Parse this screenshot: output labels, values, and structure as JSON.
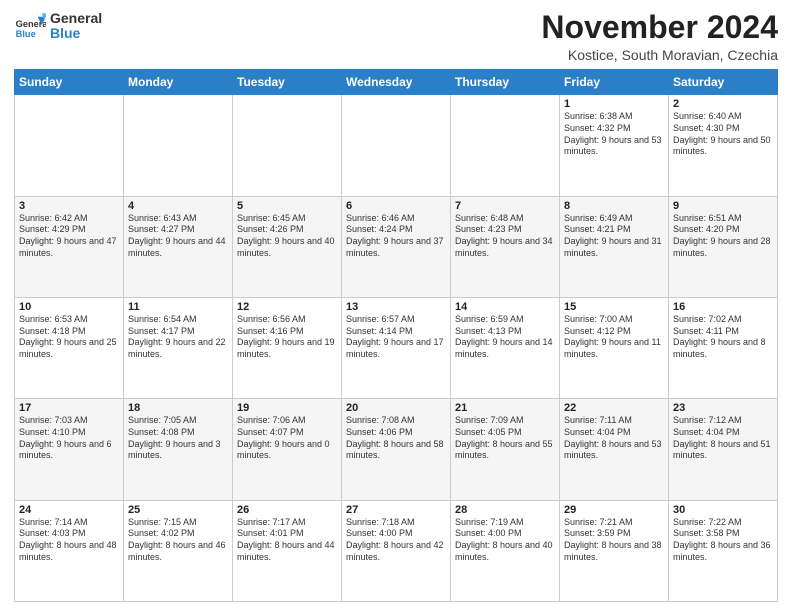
{
  "logo": {
    "general": "General",
    "blue": "Blue"
  },
  "title": "November 2024",
  "location": "Kostice, South Moravian, Czechia",
  "days_of_week": [
    "Sunday",
    "Monday",
    "Tuesday",
    "Wednesday",
    "Thursday",
    "Friday",
    "Saturday"
  ],
  "weeks": [
    [
      {
        "day": "",
        "info": ""
      },
      {
        "day": "",
        "info": ""
      },
      {
        "day": "",
        "info": ""
      },
      {
        "day": "",
        "info": ""
      },
      {
        "day": "",
        "info": ""
      },
      {
        "day": "1",
        "info": "Sunrise: 6:38 AM\nSunset: 4:32 PM\nDaylight: 9 hours and 53 minutes."
      },
      {
        "day": "2",
        "info": "Sunrise: 6:40 AM\nSunset: 4:30 PM\nDaylight: 9 hours and 50 minutes."
      }
    ],
    [
      {
        "day": "3",
        "info": "Sunrise: 6:42 AM\nSunset: 4:29 PM\nDaylight: 9 hours and 47 minutes."
      },
      {
        "day": "4",
        "info": "Sunrise: 6:43 AM\nSunset: 4:27 PM\nDaylight: 9 hours and 44 minutes."
      },
      {
        "day": "5",
        "info": "Sunrise: 6:45 AM\nSunset: 4:26 PM\nDaylight: 9 hours and 40 minutes."
      },
      {
        "day": "6",
        "info": "Sunrise: 6:46 AM\nSunset: 4:24 PM\nDaylight: 9 hours and 37 minutes."
      },
      {
        "day": "7",
        "info": "Sunrise: 6:48 AM\nSunset: 4:23 PM\nDaylight: 9 hours and 34 minutes."
      },
      {
        "day": "8",
        "info": "Sunrise: 6:49 AM\nSunset: 4:21 PM\nDaylight: 9 hours and 31 minutes."
      },
      {
        "day": "9",
        "info": "Sunrise: 6:51 AM\nSunset: 4:20 PM\nDaylight: 9 hours and 28 minutes."
      }
    ],
    [
      {
        "day": "10",
        "info": "Sunrise: 6:53 AM\nSunset: 4:18 PM\nDaylight: 9 hours and 25 minutes."
      },
      {
        "day": "11",
        "info": "Sunrise: 6:54 AM\nSunset: 4:17 PM\nDaylight: 9 hours and 22 minutes."
      },
      {
        "day": "12",
        "info": "Sunrise: 6:56 AM\nSunset: 4:16 PM\nDaylight: 9 hours and 19 minutes."
      },
      {
        "day": "13",
        "info": "Sunrise: 6:57 AM\nSunset: 4:14 PM\nDaylight: 9 hours and 17 minutes."
      },
      {
        "day": "14",
        "info": "Sunrise: 6:59 AM\nSunset: 4:13 PM\nDaylight: 9 hours and 14 minutes."
      },
      {
        "day": "15",
        "info": "Sunrise: 7:00 AM\nSunset: 4:12 PM\nDaylight: 9 hours and 11 minutes."
      },
      {
        "day": "16",
        "info": "Sunrise: 7:02 AM\nSunset: 4:11 PM\nDaylight: 9 hours and 8 minutes."
      }
    ],
    [
      {
        "day": "17",
        "info": "Sunrise: 7:03 AM\nSunset: 4:10 PM\nDaylight: 9 hours and 6 minutes."
      },
      {
        "day": "18",
        "info": "Sunrise: 7:05 AM\nSunset: 4:08 PM\nDaylight: 9 hours and 3 minutes."
      },
      {
        "day": "19",
        "info": "Sunrise: 7:06 AM\nSunset: 4:07 PM\nDaylight: 9 hours and 0 minutes."
      },
      {
        "day": "20",
        "info": "Sunrise: 7:08 AM\nSunset: 4:06 PM\nDaylight: 8 hours and 58 minutes."
      },
      {
        "day": "21",
        "info": "Sunrise: 7:09 AM\nSunset: 4:05 PM\nDaylight: 8 hours and 55 minutes."
      },
      {
        "day": "22",
        "info": "Sunrise: 7:11 AM\nSunset: 4:04 PM\nDaylight: 8 hours and 53 minutes."
      },
      {
        "day": "23",
        "info": "Sunrise: 7:12 AM\nSunset: 4:04 PM\nDaylight: 8 hours and 51 minutes."
      }
    ],
    [
      {
        "day": "24",
        "info": "Sunrise: 7:14 AM\nSunset: 4:03 PM\nDaylight: 8 hours and 48 minutes."
      },
      {
        "day": "25",
        "info": "Sunrise: 7:15 AM\nSunset: 4:02 PM\nDaylight: 8 hours and 46 minutes."
      },
      {
        "day": "26",
        "info": "Sunrise: 7:17 AM\nSunset: 4:01 PM\nDaylight: 8 hours and 44 minutes."
      },
      {
        "day": "27",
        "info": "Sunrise: 7:18 AM\nSunset: 4:00 PM\nDaylight: 8 hours and 42 minutes."
      },
      {
        "day": "28",
        "info": "Sunrise: 7:19 AM\nSunset: 4:00 PM\nDaylight: 8 hours and 40 minutes."
      },
      {
        "day": "29",
        "info": "Sunrise: 7:21 AM\nSunset: 3:59 PM\nDaylight: 8 hours and 38 minutes."
      },
      {
        "day": "30",
        "info": "Sunrise: 7:22 AM\nSunset: 3:58 PM\nDaylight: 8 hours and 36 minutes."
      }
    ]
  ]
}
